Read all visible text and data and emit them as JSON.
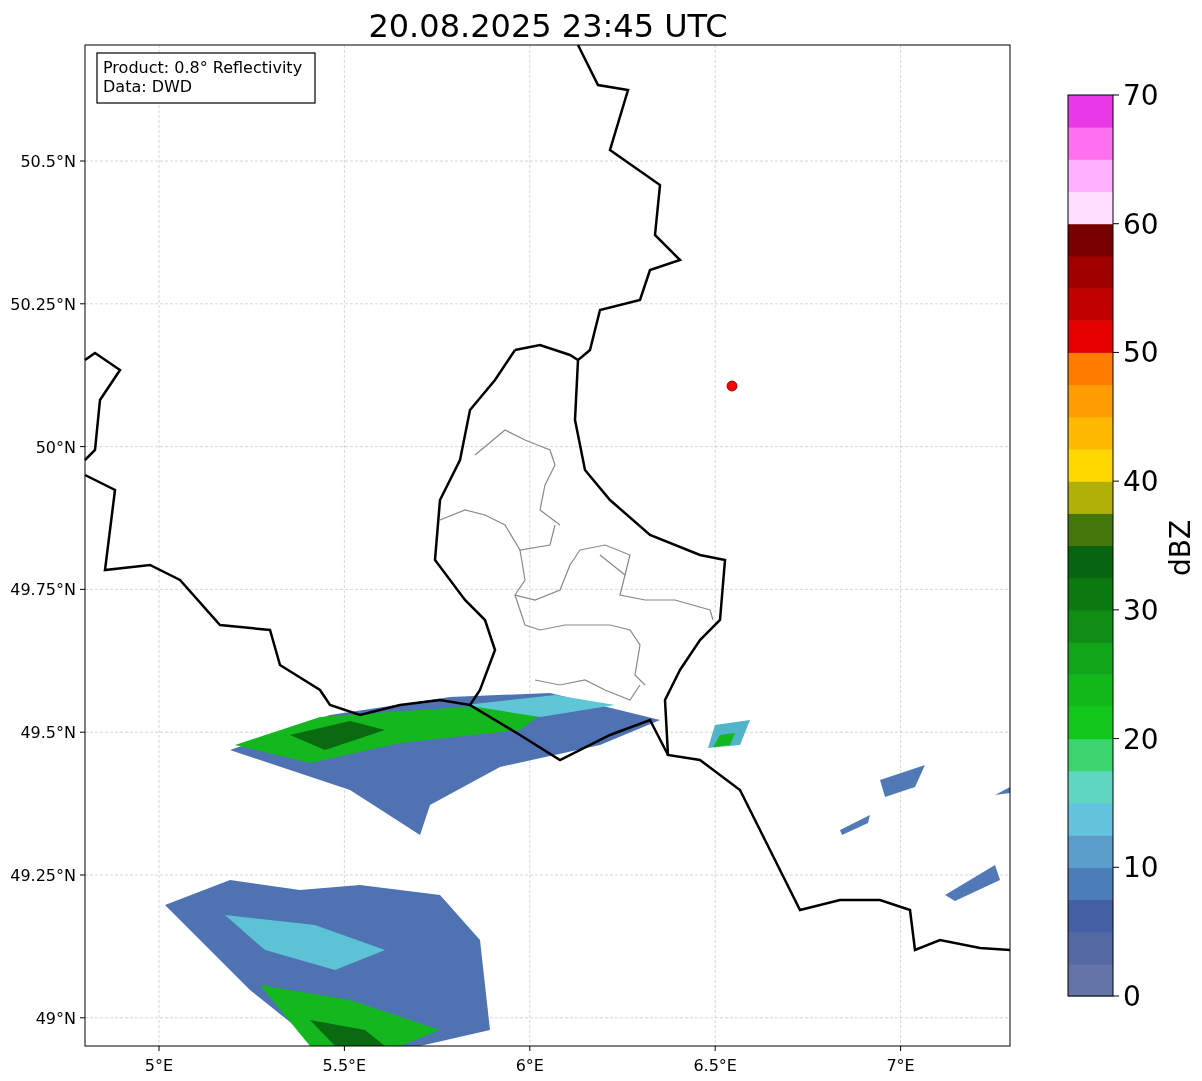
{
  "title": "20.08.2025 23:45 UTC",
  "info_box": [
    "Product: 0.8° Reflectivity",
    "Data: DWD"
  ],
  "map": {
    "y_ticks": [
      "50.5°N",
      "50.25°N",
      "50°N",
      "49.75°N",
      "49.5°N",
      "49.25°N",
      "49°N"
    ],
    "x_ticks": [
      "5°E",
      "5.5°E",
      "6°E",
      "6.5°E",
      "7°E"
    ]
  },
  "colorbar": {
    "label": "dBZ",
    "ticks": [
      "70",
      "60",
      "50",
      "40",
      "30",
      "20",
      "10",
      "0"
    ],
    "bands": [
      {
        "color": "#6474a8"
      },
      {
        "color": "#5468a4"
      },
      {
        "color": "#4360a4"
      },
      {
        "color": "#4b7db8"
      },
      {
        "color": "#5b9dcb"
      },
      {
        "color": "#63c2dc"
      },
      {
        "color": "#5fd6c0"
      },
      {
        "color": "#3cd46c"
      },
      {
        "color": "#11c81a"
      },
      {
        "color": "#10b81a"
      },
      {
        "color": "#10a418"
      },
      {
        "color": "#0e8c14"
      },
      {
        "color": "#0a7a10"
      },
      {
        "color": "#076410"
      },
      {
        "color": "#44780c"
      },
      {
        "color": "#b0b008"
      },
      {
        "color": "#ffd800"
      },
      {
        "color": "#ffb800"
      },
      {
        "color": "#ff9c00"
      },
      {
        "color": "#ff7c00"
      },
      {
        "color": "#e60000"
      },
      {
        "color": "#c00000"
      },
      {
        "color": "#a00000"
      },
      {
        "color": "#780000"
      },
      {
        "color": "#ffddff"
      },
      {
        "color": "#ffb0ff"
      },
      {
        "color": "#ff70f0"
      },
      {
        "color": "#e838e8"
      }
    ]
  }
}
